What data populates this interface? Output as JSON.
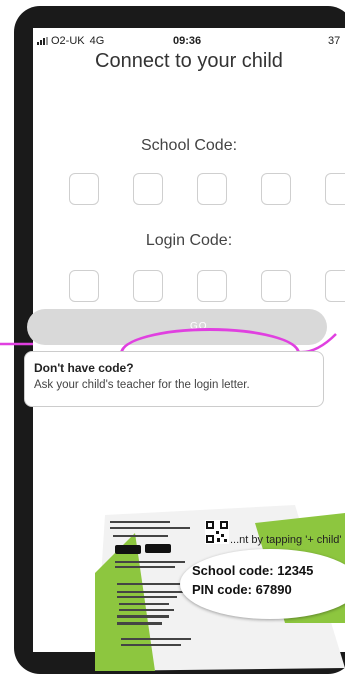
{
  "status_bar": {
    "carrier": "O2-UK",
    "network": "4G",
    "time": "09:36",
    "battery": "37"
  },
  "page": {
    "title": "Connect to your child",
    "school_code_label": "School Code:",
    "login_code_label": "Login Code:",
    "go_label": "GO"
  },
  "hint": {
    "title": "Don't have code?",
    "text": "Ask your child's teacher for the login letter."
  },
  "letter_image": {
    "school_code": "School code: 12345",
    "pin_code": "PIN code: 67890",
    "tap_text": "...nt by tapping '+ child'"
  },
  "annotation_color": "#e040e0"
}
